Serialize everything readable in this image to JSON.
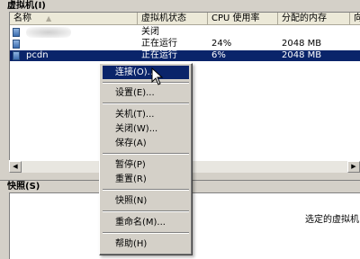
{
  "vm_panel": {
    "title": "虚拟机(I)"
  },
  "columns": [
    "名称",
    "虚拟机状态",
    "CPU 使用率",
    "分配的内存",
    "向"
  ],
  "rows": [
    {
      "name": "",
      "state": "关闭",
      "cpu": "",
      "memory": ""
    },
    {
      "name": "",
      "state": "正在运行",
      "cpu": "24%",
      "memory": "2048 MB"
    },
    {
      "name": "pcdn",
      "state": "正在运行",
      "cpu": "6%",
      "memory": "2048 MB"
    }
  ],
  "context_menu": {
    "connect": "连接(O)...",
    "settings": "设置(E)...",
    "turn_off": "关机(T)...",
    "shutdown": "关闭(W)...",
    "save": "保存(A)",
    "pause": "暂停(P)",
    "reset": "重置(R)",
    "snapshot": "快照(N)",
    "rename": "重命名(M)...",
    "help": "帮助(H)"
  },
  "snapshot_panel": {
    "title": "快照(S)",
    "message": "选定的虚拟机"
  },
  "colors": {
    "selection": "#0a246a",
    "window": "#d4d0c8"
  }
}
